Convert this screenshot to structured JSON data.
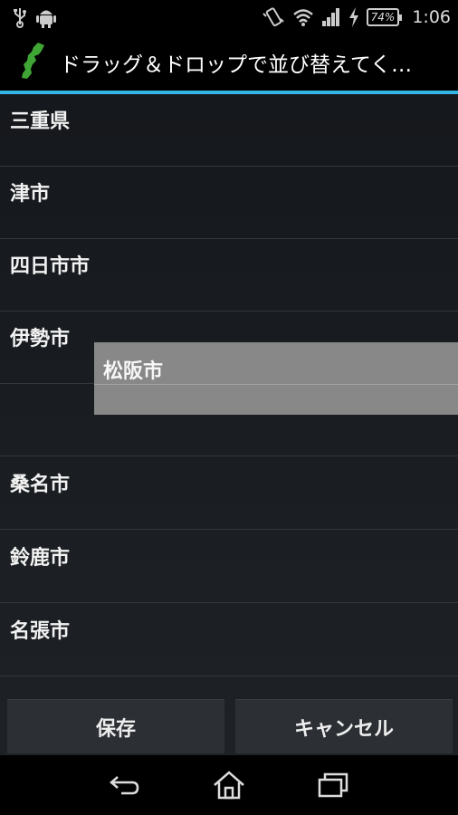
{
  "status_bar": {
    "battery": "74%",
    "time": "1:06",
    "icons": [
      "usb-icon",
      "android-icon",
      "vibrate-icon",
      "wifi-icon",
      "signal-icon",
      "charging-icon"
    ]
  },
  "action_bar": {
    "title": "ドラッグ＆ドロップで並び替えてく…",
    "app_icon": "mie-prefecture-icon",
    "divider_color": "#33b5e5"
  },
  "list": {
    "items": [
      "三重県",
      "津市",
      "四日市市",
      "伊勢市",
      "",
      "桑名市",
      "鈴鹿市",
      "名張市"
    ],
    "dragging_item": "松阪市"
  },
  "buttons": {
    "save": "保存",
    "cancel": "キャンセル"
  },
  "nav": [
    "back-icon",
    "home-icon",
    "recent-apps-icon"
  ]
}
